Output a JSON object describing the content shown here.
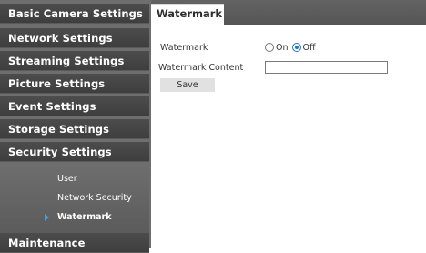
{
  "sidebar": {
    "items": [
      {
        "label": "Basic Camera Settings"
      },
      {
        "label": "Network Settings"
      },
      {
        "label": "Streaming Settings"
      },
      {
        "label": "Picture Settings"
      },
      {
        "label": "Event Settings"
      },
      {
        "label": "Storage Settings"
      },
      {
        "label": "Security Settings"
      },
      {
        "label": "Maintenance"
      }
    ],
    "security_subitems": [
      {
        "label": "User"
      },
      {
        "label": "Network Security"
      },
      {
        "label": "Watermark",
        "active": true
      }
    ],
    "active_arrow_icon": "triangle-right-icon",
    "arrow_color": "#3f9fe0"
  },
  "tab": {
    "label": "Watermark"
  },
  "form": {
    "watermark_label": "Watermark",
    "on_label": "On",
    "off_label": "Off",
    "selected": "Off",
    "content_label": "Watermark Content",
    "content_value": "",
    "save_label": "Save"
  }
}
